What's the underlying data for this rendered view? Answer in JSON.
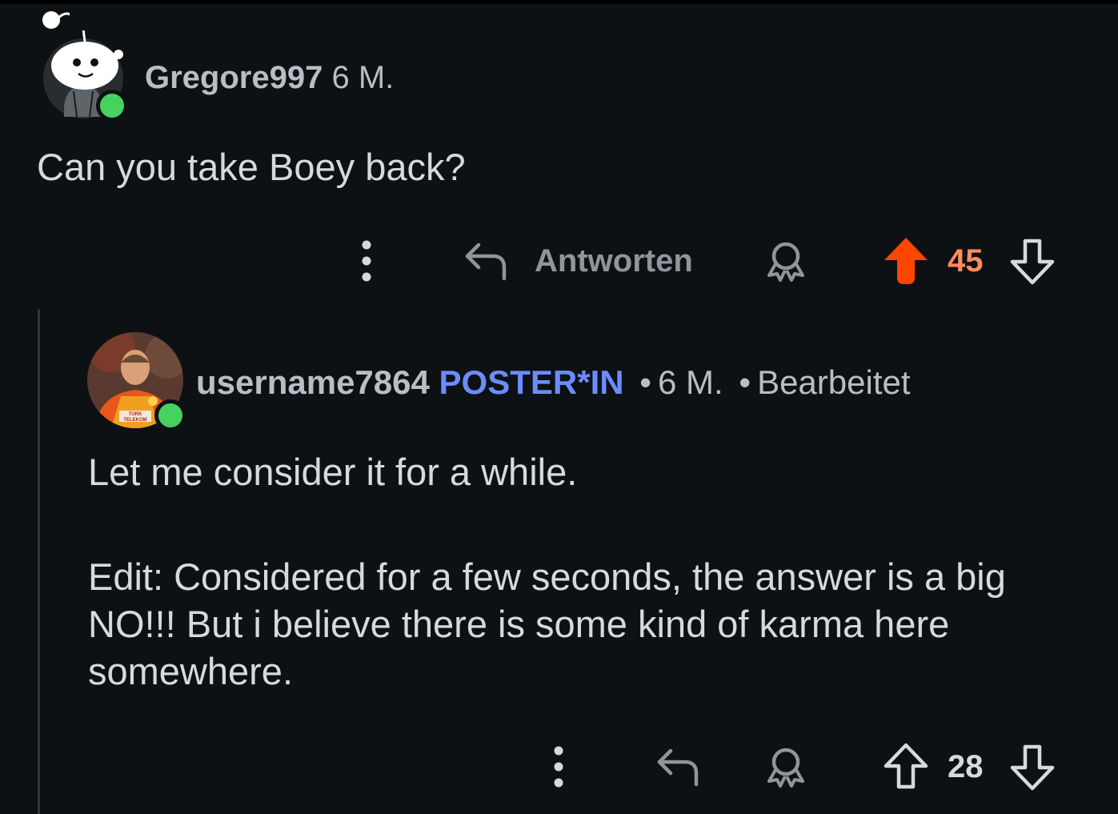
{
  "comments": [
    {
      "author": "Gregore997",
      "age": "6 M.",
      "body": "Can you take Boey back?",
      "actions": {
        "reply_label": "Antworten",
        "score": "45",
        "upvoted": true
      },
      "avatar": "reddit-snoo-avatar",
      "online": true
    },
    {
      "author": "username7864",
      "op_badge": "POSTER*IN",
      "age": "6 M.",
      "edited_label": "Bearbeitet",
      "separator": "•",
      "body_paragraphs": [
        "Let me consider it for a while.",
        "Edit: Considered for a few seconds, the answer is a big NO!!! But i believe there is some kind of karma here somewhere."
      ],
      "actions": {
        "score": "28",
        "upvoted": false
      },
      "avatar": "footballer-photo-avatar",
      "avatar_text": "TÜRK TELEKOM",
      "online": true
    }
  ],
  "icons": {
    "more": "more-vertical-icon",
    "reply": "reply-arrow-icon",
    "award": "award-icon",
    "upvote": "upvote-arrow-icon",
    "downvote": "downvote-arrow-icon"
  },
  "colors": {
    "background": "#0e1113",
    "upvote_active": "#ff4500",
    "score_active": "#ff8b60",
    "op_badge": "#6b8cff",
    "online": "#46d160",
    "muted_text": "#b8bec3",
    "body_text": "#d7dadc"
  }
}
